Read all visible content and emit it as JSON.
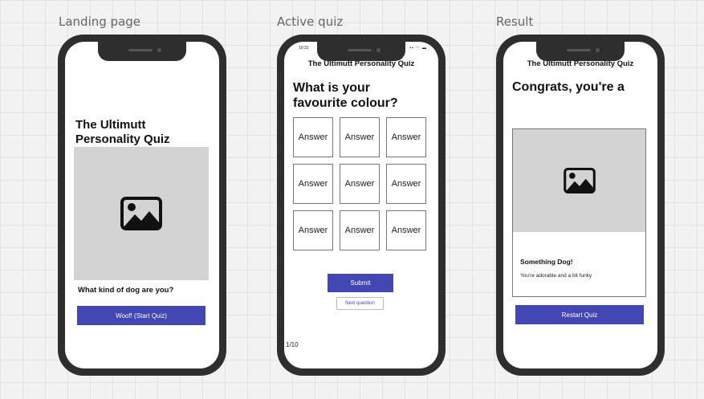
{
  "frames": {
    "landing_label": "Landing page",
    "quiz_label": "Active quiz",
    "result_label": "Result"
  },
  "landing": {
    "title": "The Ultimutt Personality Quiz",
    "subtitle": "What kind of dog are you?",
    "start_button": "Woof! (Start Quiz)",
    "image_icon": "image-icon"
  },
  "quiz": {
    "status_time": "10:31",
    "status_icons": "▪▪ ◠ ▬",
    "app_title": "The Ultimutt Personality Quiz",
    "question": "What is your favourite colour?",
    "answers": [
      "Answer",
      "Answer",
      "Answer",
      "Answer",
      "Answer",
      "Answer",
      "Answer",
      "Answer",
      "Answer"
    ],
    "submit_button": "Submit",
    "next_button": "Next question",
    "progress": "1/10"
  },
  "result": {
    "app_title": "The Ultimutt Personality Quiz",
    "heading": "Congrats, you're a",
    "dog_name": "Something Dog!",
    "description": "You're adorable and a bit funky",
    "restart_button": "Restart Quiz",
    "image_icon": "image-icon"
  },
  "colors": {
    "accent": "#4347b4",
    "phone_body": "#2e2e2e",
    "placeholder": "#d3d3d3"
  }
}
